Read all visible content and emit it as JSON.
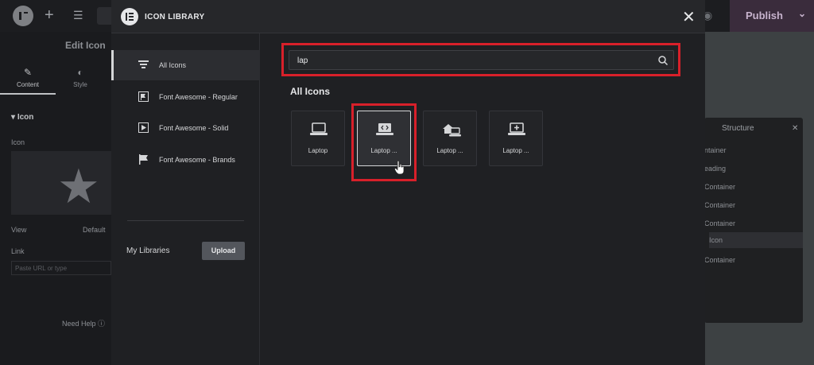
{
  "editor": {
    "publish_label": "Publish",
    "panel_title": "Edit Icon",
    "tabs": [
      {
        "label": "Content"
      },
      {
        "label": "Style"
      }
    ],
    "section_label": "Icon",
    "field_icon_label": "Icon",
    "field_view_label": "View",
    "field_view_value": "Default",
    "field_link_label": "Link",
    "field_link_placeholder": "Paste URL or type",
    "need_help": "Need Help"
  },
  "structure": {
    "title": "Structure",
    "items": [
      "ntainer",
      "eading",
      "Container",
      "Container",
      "Container",
      "Icon",
      "Container"
    ]
  },
  "modal": {
    "title": "ICON LIBRARY",
    "categories": [
      {
        "label": "All Icons",
        "icon": "list-icon",
        "active": true
      },
      {
        "label": "Font Awesome - Regular",
        "icon": "flag-regular-icon"
      },
      {
        "label": "Font Awesome - Solid",
        "icon": "play-solid-icon"
      },
      {
        "label": "Font Awesome - Brands",
        "icon": "flag-icon"
      }
    ],
    "my_libraries_label": "My Libraries",
    "upload_label": "Upload",
    "search_value": "lap",
    "results_title": "All Icons",
    "icons": [
      {
        "label": "Laptop",
        "icon": "laptop-icon",
        "selected": false
      },
      {
        "label": "Laptop ...",
        "icon": "laptop-code-icon",
        "selected": true
      },
      {
        "label": "Laptop ...",
        "icon": "laptop-house-icon",
        "selected": false
      },
      {
        "label": "Laptop ...",
        "icon": "laptop-medical-icon",
        "selected": false
      }
    ]
  },
  "colors": {
    "highlight_red": "#d8202a",
    "modal_bg": "#1f2023",
    "publish_bg": "#3a2c3c"
  }
}
